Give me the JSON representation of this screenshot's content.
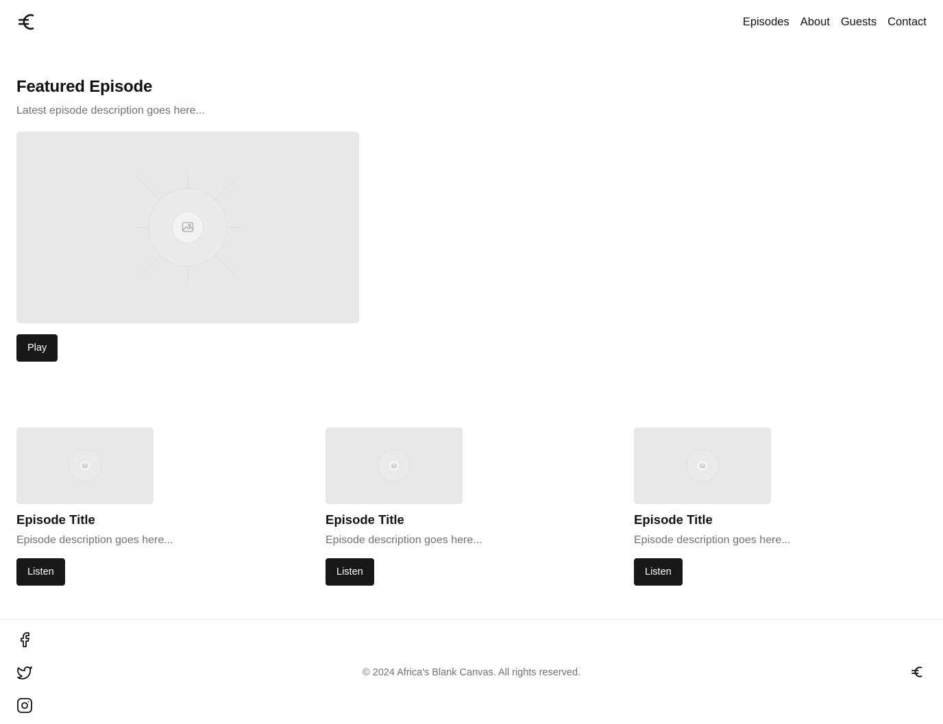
{
  "header": {
    "logo_icon": "euro-sign-icon",
    "nav": [
      {
        "label": "Episodes"
      },
      {
        "label": "About"
      },
      {
        "label": "Guests"
      },
      {
        "label": "Contact"
      }
    ]
  },
  "featured": {
    "title": "Featured Episode",
    "description": "Latest episode description goes here...",
    "image_icon": "image-placeholder-icon",
    "play_label": "Play"
  },
  "episodes": [
    {
      "title": "Episode Title",
      "description": "Episode description goes here...",
      "button_label": "Listen"
    },
    {
      "title": "Episode Title",
      "description": "Episode description goes here...",
      "button_label": "Listen"
    },
    {
      "title": "Episode Title",
      "description": "Episode description goes here...",
      "button_label": "Listen"
    }
  ],
  "footer": {
    "social_icons": [
      "facebook-icon",
      "twitter-icon",
      "instagram-icon"
    ],
    "copyright": "© 2024 Africa's Blank Canvas. All rights reserved.",
    "logo_icon": "euro-sign-icon"
  },
  "colors": {
    "button_bg": "#18181b",
    "placeholder_bg": "#e8e8e8",
    "muted_text": "#6b7280",
    "divider": "#e5e7eb"
  }
}
